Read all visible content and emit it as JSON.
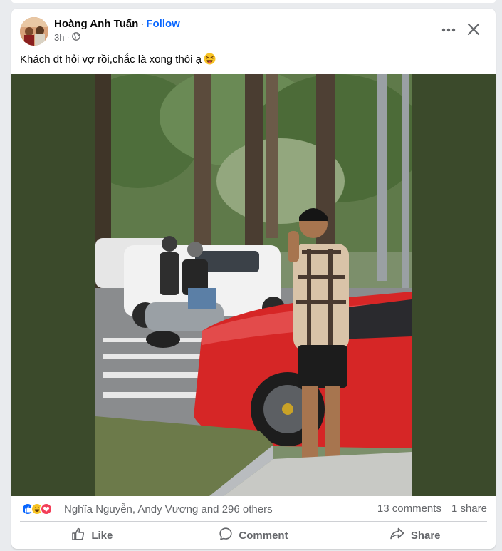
{
  "post": {
    "author": "Hoàng Anh Tuấn",
    "separator": "·",
    "follow_label": "Follow",
    "time": "3h",
    "time_separator": "·",
    "privacy_icon": "globe-icon",
    "caption": "Khách dt hỏi vợ rồi,chắc là xong thôi ạ",
    "caption_emoji": "squinting-tongue-emoji"
  },
  "reactions": {
    "icons": [
      "like-reaction-icon",
      "haha-reaction-icon",
      "love-reaction-icon"
    ],
    "names": "Nghĩa Nguyễn, Andy Vương and 296 others",
    "comments": "13 comments",
    "shares": "1 share"
  },
  "actions": {
    "like": "Like",
    "comment": "Comment",
    "share": "Share"
  },
  "colors": {
    "link": "#0866ff",
    "secondary_text": "#65676b",
    "media_background": "#3b4a2b",
    "car": "#d62626"
  }
}
